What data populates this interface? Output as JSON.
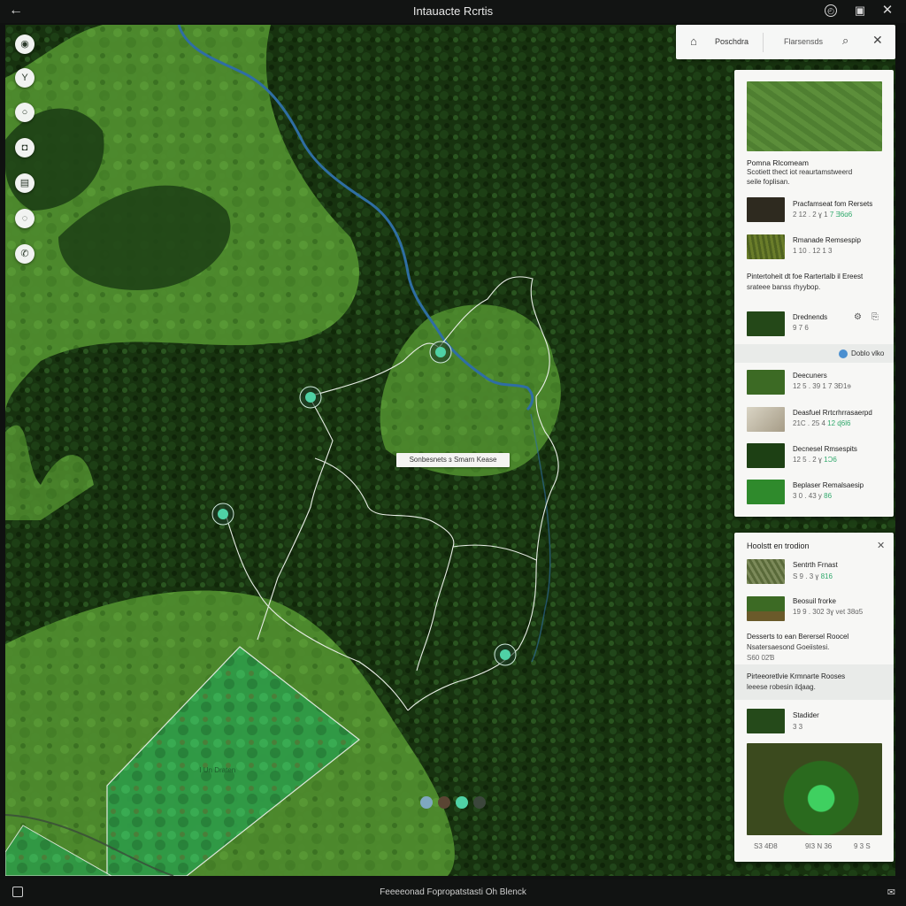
{
  "titlebar": {
    "title": "Intauacte Rcrtis",
    "back_icon": "arrow-left-icon",
    "right_icons": [
      "clock-icon",
      "layers-icon",
      "close-icon"
    ]
  },
  "left_tools": [
    {
      "name": "location-icon",
      "glyph": "◉"
    },
    {
      "name": "filter-icon",
      "glyph": "Y"
    },
    {
      "name": "circle-icon",
      "glyph": "○"
    },
    {
      "name": "camera-icon",
      "glyph": "◘"
    },
    {
      "name": "list-icon",
      "glyph": "▤"
    },
    {
      "name": "chat-icon",
      "glyph": "◌"
    },
    {
      "name": "phone-icon",
      "glyph": "✆"
    }
  ],
  "search": {
    "place": "Poschdra",
    "results": "Flarsensds"
  },
  "map": {
    "area_label": "Sonbesnets ɜ Smarn Kease",
    "field_label": "l Un Draten",
    "colors": {
      "river": "#2f6ea3",
      "trail": "#e8ede6",
      "marker": "#4fd1a5",
      "forest_dark": "#16300f",
      "grass": "#4c8a2c"
    },
    "carousel": [
      "#7fa8c0",
      "#5a4533",
      "#4fd1a5",
      "#3b463b"
    ]
  },
  "panel1": {
    "header_title": "Pomna Rlcomeam",
    "header_desc1": "Scotiett thect iot reaurtamstweerd",
    "header_desc2": "seile foplisan.",
    "items": [
      {
        "title": "Pracfamseat fom Rersets",
        "meta_a": "2 12",
        "meta_b": ". 2 ɣ 1",
        "meta_hl": "7 Ǝ6ɑ6"
      },
      {
        "title": "Rmanade Remsespip",
        "meta_a": "1 10",
        "meta_b": ". 12 1 3",
        "meta_hl": ""
      }
    ],
    "section_title": "Pintertoheit dt foe  Rartertalb il Ereest",
    "section_desc": "srateee banss rhyybop.",
    "item3": {
      "title": "Drednends",
      "meta": "9 7 6",
      "icons": [
        "settings-icon",
        "share-icon"
      ]
    },
    "highlight_label": "Doblo vlko",
    "items2": [
      {
        "title": "Deecuners",
        "meta_a": "12 5",
        "meta_b": ". 39 1  7 3Ɖ1ɘ",
        "meta_hl": ""
      },
      {
        "title": "Deasfuel Rrtcrhrrasaerpd",
        "meta_a": "21C",
        "meta_b": ". 25 4",
        "meta_hl": "12 ɖ6l6"
      },
      {
        "title": "Decnesel Rmsespits",
        "meta_a": "12 5",
        "meta_b": ". 2 ɣ",
        "meta_hl": "1Ɔ6"
      },
      {
        "title": "Beplaser Remalsaesip",
        "meta_a": "3 0",
        "meta_b": ". 43  y",
        "meta_hl": "86"
      }
    ]
  },
  "panel2": {
    "title": "Hoolstt en trodion",
    "items": [
      {
        "title": "Sentrth Frnast",
        "meta_a": "S 9",
        "meta_b": ". 3 ɣ",
        "meta_hl": "816"
      },
      {
        "title": "Beosuil frorke",
        "meta_a": "19 9",
        "meta_b": ". 302  3ɣ vet 38ɑ5",
        "meta_hl": ""
      }
    ],
    "section_title": "Desserts to ean Berersel Roocel",
    "section_desc": "Nsatersaesond Goeiistesi.",
    "section_meta": "S60 02Ɓ",
    "hl_title": "Pirteeoretlvie Krmnarte Rooses",
    "hl_desc": "leeese robesin ilɖaag.",
    "item3": {
      "title": "Stadider",
      "meta": "3 3"
    },
    "stats": [
      "S3 4Ɖ8",
      "9I3 N 36",
      "9 3 S"
    ]
  },
  "statusbar": {
    "text": "Feeeeonad  Fopropatstasti Oh Blenck"
  }
}
